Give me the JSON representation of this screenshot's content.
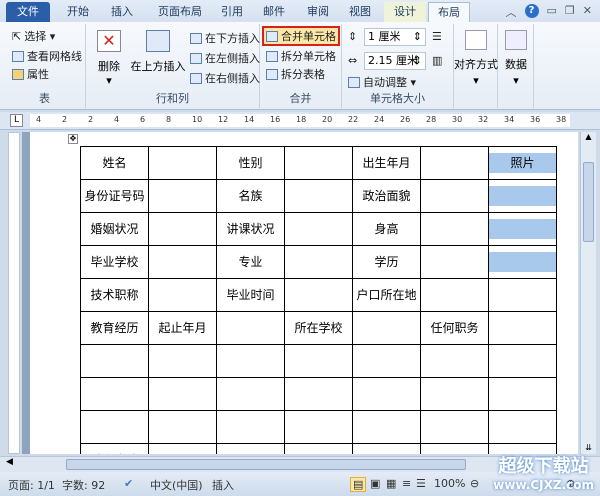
{
  "tabs": [
    "文件",
    "开始",
    "插入",
    "页面布局",
    "引用",
    "邮件",
    "审阅",
    "视图",
    "设计",
    "布局"
  ],
  "ribbon": {
    "table": {
      "select": "选择 ▾",
      "gridlines": "查看网格线",
      "properties": "属性",
      "label": "表"
    },
    "rowscols": {
      "delete": "删除",
      "insert_above": "在上方插入",
      "insert_below": "在下方插入",
      "insert_left": "在左侧插入",
      "insert_right": "在右侧插入",
      "label": "行和列"
    },
    "merge": {
      "merge_cells": "合并单元格",
      "split_cells": "拆分单元格",
      "split_table": "拆分表格",
      "label": "合并"
    },
    "cellsize": {
      "height": "1 厘米",
      "width": "2.15 厘米",
      "autofit": "自动调整 ▾",
      "label": "单元格大小"
    },
    "align": {
      "label": "对齐方式"
    },
    "data": {
      "label": "数据"
    }
  },
  "ruler": [
    "4",
    "2",
    "2",
    "4",
    "6",
    "8",
    "10",
    "12",
    "14",
    "16",
    "18",
    "20",
    "22",
    "24",
    "26",
    "28",
    "30",
    "32",
    "34",
    "36",
    "38"
  ],
  "table": [
    [
      "姓名",
      "",
      "性别",
      "",
      "出生年月",
      "",
      "照片"
    ],
    [
      "身份证号码",
      "",
      "名族",
      "",
      "政治面貌",
      "",
      ""
    ],
    [
      "婚姻状况",
      "",
      "讲课状况",
      "",
      "身高",
      "",
      ""
    ],
    [
      "毕业学校",
      "",
      "专业",
      "",
      "学历",
      "",
      ""
    ],
    [
      "技术职称",
      "",
      "毕业时间",
      "",
      "户口所在地",
      "",
      ""
    ],
    [
      "教育经历",
      "起止年月",
      "",
      "所在学校",
      "",
      "任何职务",
      ""
    ],
    [
      "",
      "",
      "",
      "",
      "",
      "",
      ""
    ],
    [
      "",
      "",
      "",
      "",
      "",
      "",
      ""
    ],
    [
      "",
      "",
      "",
      "",
      "",
      "",
      ""
    ],
    [
      "社会实践",
      "",
      "",
      "",
      "",
      "",
      ""
    ]
  ],
  "status": {
    "page": "页面: 1/1",
    "words": "字数: 92",
    "lang": "中文(中国)",
    "mode": "插入",
    "zoom": "100%"
  },
  "watermark": {
    "title": "超级下载站",
    "url": "www.CJXZ.com"
  }
}
